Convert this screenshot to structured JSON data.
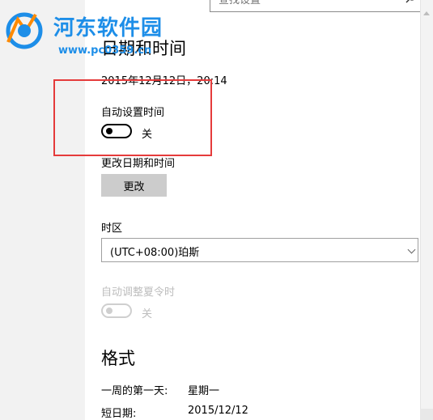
{
  "search": {
    "placeholder": "查找设置"
  },
  "page": {
    "title": "日期和时间",
    "current_datetime": "2015年12月12日，20:14"
  },
  "auto_time": {
    "label": "自动设置时间",
    "state": "关"
  },
  "change_datetime": {
    "label": "更改日期和时间",
    "button": "更改"
  },
  "timezone": {
    "label": "时区",
    "value": "(UTC+08:00)珀斯"
  },
  "dst": {
    "label": "自动调整夏令时",
    "state": "关"
  },
  "format": {
    "title": "格式",
    "rows": [
      {
        "label": "一周的第一天:",
        "value": "星期一"
      },
      {
        "label": "短日期:",
        "value": "2015/12/12"
      }
    ]
  },
  "watermark": {
    "brand": "河东软件园",
    "url": "www.pc0359.cn"
  },
  "colors": {
    "highlight": "#e53b3b",
    "watermark": "#1d8ee8",
    "button_bg": "#cccccc"
  }
}
